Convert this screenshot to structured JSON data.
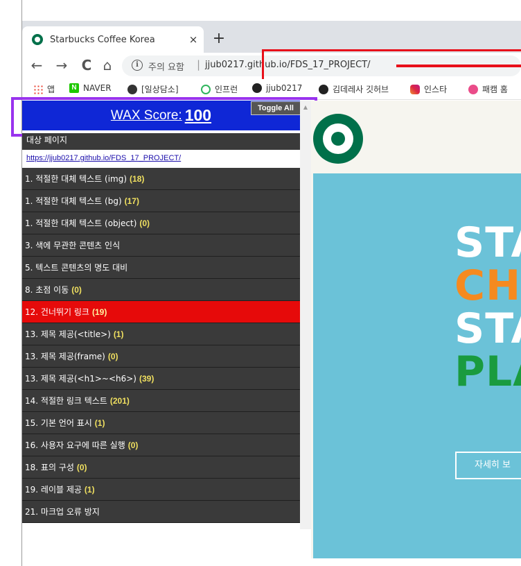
{
  "browser": {
    "tab": {
      "title": "Starbucks Coffee Korea",
      "close": "×"
    },
    "new_tab": "+",
    "nav": {
      "back": "←",
      "forward": "→",
      "reload": "C",
      "home": "⌂"
    },
    "omnibox": {
      "info": "i",
      "security_text": "주의 요함",
      "separator": "|",
      "url": "jjub0217.github.io/FDS_17_PROJECT/"
    },
    "bookmarks": [
      {
        "label": "앱",
        "icon": "apps-icon"
      },
      {
        "label": "NAVER",
        "icon": "naver-icon",
        "badge": "N"
      },
      {
        "label": "[일상담소]",
        "icon": "chrome-icon"
      },
      {
        "label": "인프런",
        "icon": "inflearn-icon"
      },
      {
        "label": "jjub0217",
        "icon": "github-icon"
      },
      {
        "label": "김데레사 깃허브",
        "icon": "github-icon"
      },
      {
        "label": "인스타",
        "icon": "instagram-icon"
      },
      {
        "label": "패캠 홈",
        "icon": "dribbble-icon"
      }
    ]
  },
  "wax": {
    "score_label": "WAX Score:",
    "score_value": "100",
    "toggle_all": "Toggle All",
    "target_title": "대상 페이지",
    "target_url": "https://jjub0217.github.io/FDS_17_PROJECT/",
    "items": [
      {
        "label": "1. 적절한 대체 텍스트 (img)",
        "count": "(18)"
      },
      {
        "label": "1. 적절한 대체 텍스트 (bg)",
        "count": "(17)"
      },
      {
        "label": "1. 적절한 대체 텍스트 (object)",
        "count": "(0)"
      },
      {
        "label": "3. 색에 무관한 콘텐츠 인식",
        "count": ""
      },
      {
        "label": "5. 텍스트 콘텐츠의 명도 대비",
        "count": ""
      },
      {
        "label": "8. 초점 이동",
        "count": "(0)"
      },
      {
        "label": "12. 건너뛰기 링크",
        "count": "(19)",
        "active": true
      },
      {
        "label": "13. 제목 제공(<title>)",
        "count": "(1)"
      },
      {
        "label": "13. 제목 제공(frame)",
        "count": "(0)"
      },
      {
        "label": "13. 제목 제공(<h1>~<h6>)",
        "count": "(39)"
      },
      {
        "label": "14. 적절한 링크 텍스트",
        "count": "(201)"
      },
      {
        "label": "15. 기본 언어 표시",
        "count": "(1)"
      },
      {
        "label": "16. 사용자 요구에 따른 실행",
        "count": "(0)"
      },
      {
        "label": "18. 표의 구성",
        "count": "(0)"
      },
      {
        "label": "19. 레이블 제공",
        "count": "(1)"
      },
      {
        "label": "21. 마크업 오류 방지",
        "count": ""
      }
    ]
  },
  "page": {
    "hero_lines": [
      {
        "text": "STA",
        "color": "#ffffff"
      },
      {
        "text": "CH",
        "color": "#f58a1f"
      },
      {
        "text": "STA",
        "color": "#ffffff"
      },
      {
        "text": "PLA",
        "color": "#1a9b3f"
      }
    ],
    "cta": "자세히 보",
    "colors": {
      "brand_green": "#00704a",
      "wax_blue": "#0f27d6",
      "active_red": "#e60a0a",
      "highlight_red": "#e8101a",
      "highlight_purple": "#9933ee"
    }
  }
}
